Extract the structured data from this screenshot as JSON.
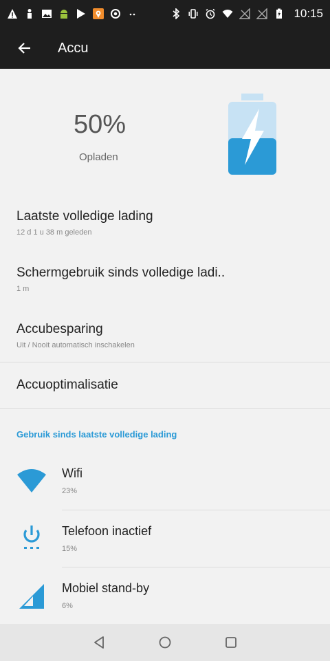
{
  "status_bar": {
    "time": "10:15",
    "icons_left": [
      "warning-icon",
      "person-icon",
      "image-icon",
      "android-icon",
      "play-store-icon",
      "maps-icon",
      "chrome-icon",
      "more-icon"
    ],
    "icons_right": [
      "bluetooth-icon",
      "vibrate-icon",
      "alarm-icon",
      "wifi-icon",
      "no-signal-icon",
      "no-signal-icon",
      "battery-charging-icon"
    ]
  },
  "app_bar": {
    "title": "Accu"
  },
  "battery": {
    "percent_label": "50%",
    "level": 0.5,
    "status": "Opladen",
    "color": "#2b9ad6"
  },
  "settings": [
    {
      "title": "Laatste volledige lading",
      "subtitle": "12 d 1 u 38 m geleden"
    },
    {
      "title": "Schermgebruik sinds volledige ladi..",
      "subtitle": "1 m"
    },
    {
      "title": "Accubesparing",
      "subtitle": "Uit / Nooit automatisch inschakelen"
    },
    {
      "title": "Accuoptimalisatie",
      "subtitle": ""
    }
  ],
  "usage_section": {
    "header": "Gebruik sinds laatste volledige lading",
    "items": [
      {
        "name": "Wifi",
        "percent": "23%",
        "icon": "wifi-icon"
      },
      {
        "name": "Telefoon inactief",
        "percent": "15%",
        "icon": "power-icon"
      },
      {
        "name": "Mobiel stand-by",
        "percent": "6%",
        "icon": "cell-signal-icon"
      }
    ]
  },
  "accent_color": "#2b9ad6"
}
